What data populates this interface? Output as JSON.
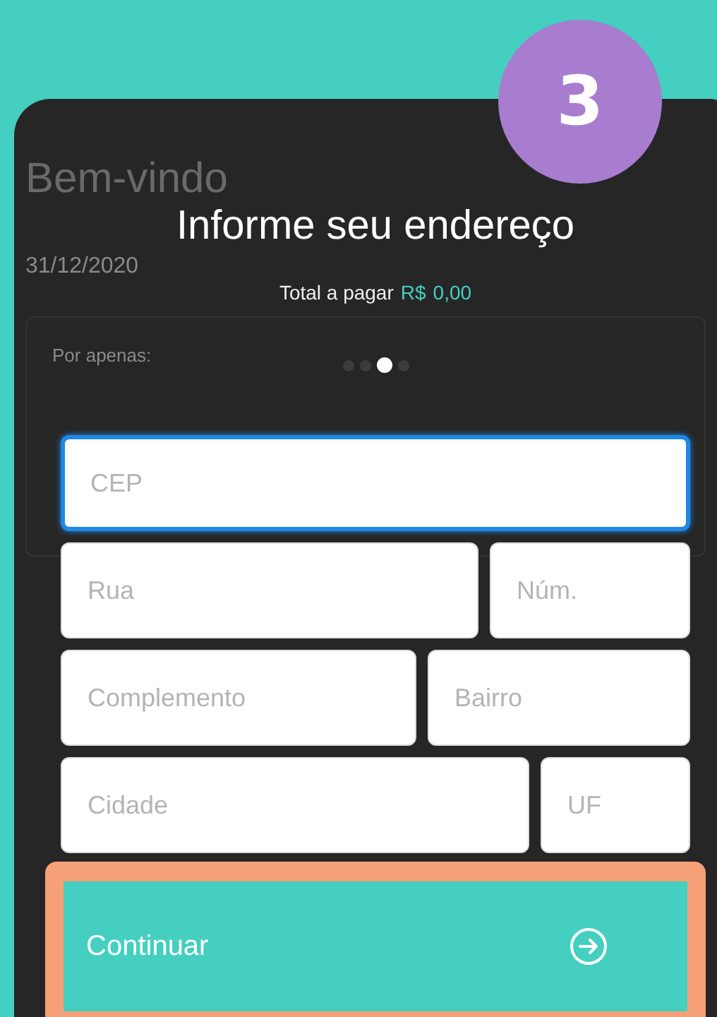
{
  "background_page": {
    "title": "Bem-vindo",
    "date": "31/12/2020",
    "price_label": "Por apenas:"
  },
  "step_badge": "3",
  "modal": {
    "title": "Informe seu endereço",
    "total_label": "Total a pagar",
    "currency": "R$",
    "total_value": "0,00"
  },
  "steps": [
    {
      "selected": false
    },
    {
      "selected": false
    },
    {
      "selected": true
    },
    {
      "selected": false
    }
  ],
  "field_rows": [
    [
      {
        "placeholder": "CEP",
        "focused": true
      }
    ],
    [
      {
        "placeholder": "Rua",
        "focused": false
      },
      {
        "placeholder": "Núm.",
        "focused": false
      }
    ],
    [
      {
        "placeholder": "Complemento",
        "focused": false
      },
      {
        "placeholder": "Bairro",
        "focused": false
      }
    ],
    [
      {
        "placeholder": "Cidade",
        "focused": false
      },
      {
        "placeholder": "UF",
        "focused": false
      }
    ]
  ],
  "continue_button": {
    "label": "Continuar"
  }
}
